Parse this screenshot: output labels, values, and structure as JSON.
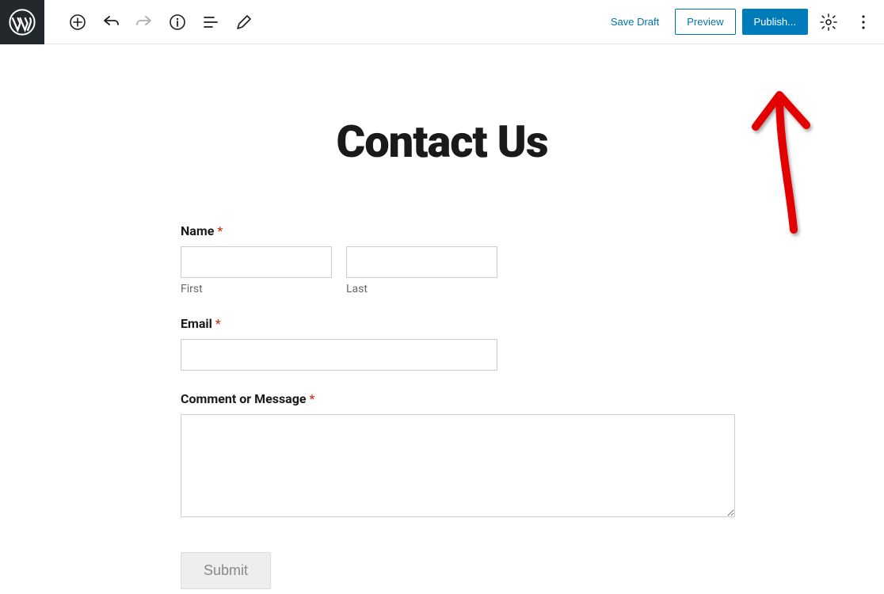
{
  "topbar": {
    "save_draft_label": "Save Draft",
    "preview_label": "Preview",
    "publish_label": "Publish..."
  },
  "page": {
    "title": "Contact Us"
  },
  "form": {
    "name_label": "Name",
    "first_label": "First",
    "last_label": "Last",
    "email_label": "Email",
    "message_label": "Comment or Message",
    "required_mark": "*",
    "submit_label": "Submit"
  }
}
